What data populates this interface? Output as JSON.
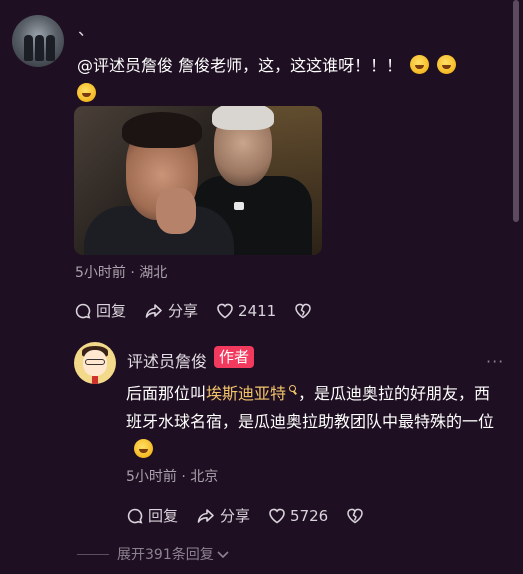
{
  "first_comment": {
    "username": "、",
    "text": "@评述员詹俊 詹俊老师，这，这这谁呀！！！",
    "time_location": "5小时前 · 湖北",
    "actions": {
      "reply": "回复",
      "share": "分享",
      "likes": "2411"
    }
  },
  "reply": {
    "username": "评述员詹俊",
    "badge": "作者",
    "text_before": "后面那位叫",
    "link_text": "埃斯迪亚特",
    "text_after": "，是瓜迪奥拉的好朋友，西班牙水球名宿，是瓜迪奥拉助教团队中最特殊的一位",
    "time_location": "5小时前 · 北京",
    "actions": {
      "reply": "回复",
      "share": "分享",
      "likes": "5726"
    }
  },
  "expand_replies": "展开391条回复"
}
